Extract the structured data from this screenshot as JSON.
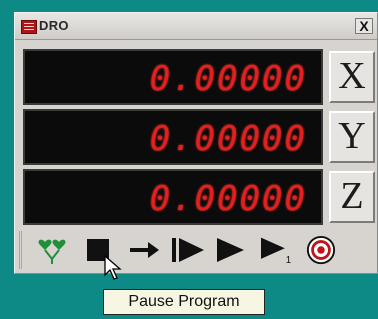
{
  "window": {
    "title": "DRO",
    "close_label": "X"
  },
  "dro": [
    {
      "axis": "X",
      "value": "0.00000"
    },
    {
      "axis": "Y",
      "value": "0.00000"
    },
    {
      "axis": "Z",
      "value": "0.00000"
    }
  ],
  "toolbar": {
    "icons": [
      "heart-tree-icon",
      "stop-icon",
      "step-arrow-icon",
      "run-from-line-icon",
      "play-icon",
      "single-step-icon",
      "target-icon"
    ],
    "single_step_sub": "1"
  },
  "tooltip": {
    "text": "Pause Program"
  },
  "colors": {
    "digits": "#e3201f",
    "background": "#0e8a86",
    "window": "#d7d4d0"
  }
}
